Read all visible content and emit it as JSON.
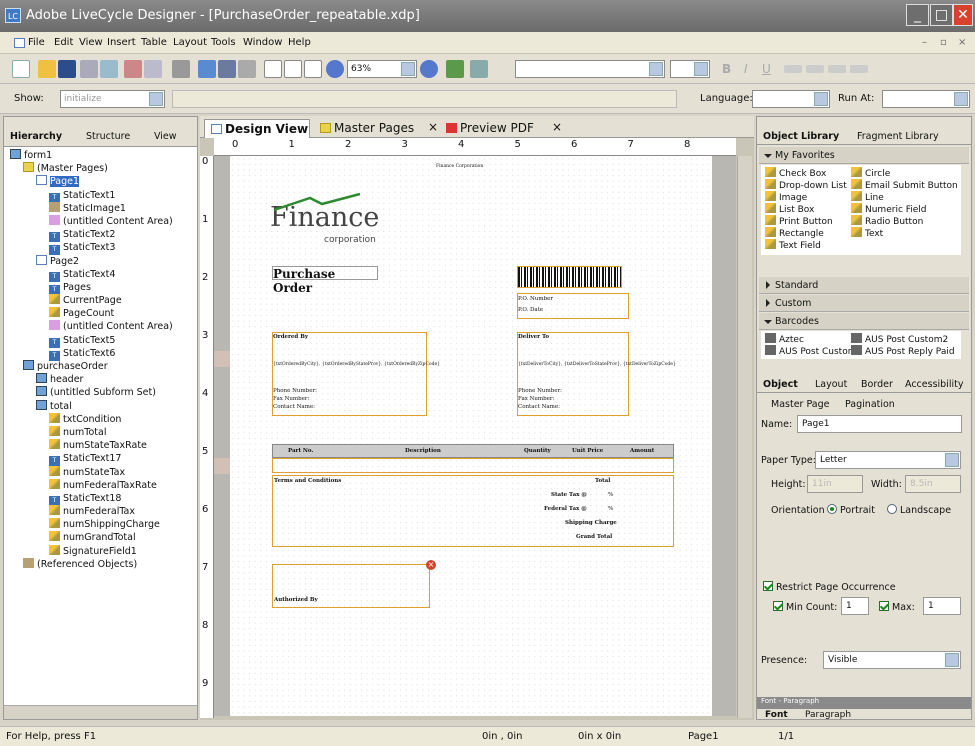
{
  "window": {
    "title": "Adobe LiveCycle Designer - [PurchaseOrder_repeatable.xdp]",
    "app_icon_text": "LC",
    "min": "_",
    "max": "□",
    "close": "✕"
  },
  "menu": [
    "File",
    "Edit",
    "View",
    "Insert",
    "Table",
    "Layout",
    "Tools",
    "Window",
    "Help"
  ],
  "toolbar": {
    "zoom": "63%",
    "bold": "B",
    "italic": "I",
    "underline": "U"
  },
  "showbar": {
    "show_label": "Show:",
    "show_value": "initialize",
    "language_label": "Language:",
    "runat_label": "Run At:"
  },
  "hierarchy": {
    "tabs": [
      "Hierarchy",
      "Structure",
      "View"
    ],
    "items": [
      {
        "label": "form1",
        "depth": 0,
        "icon": "sf"
      },
      {
        "label": "(Master Pages)",
        "depth": 1,
        "icon": "fp"
      },
      {
        "label": "Page1",
        "depth": 2,
        "icon": "pg",
        "selected": true
      },
      {
        "label": "StaticText1",
        "depth": 3,
        "icon": "tt"
      },
      {
        "label": "StaticImage1",
        "depth": 3,
        "icon": "img"
      },
      {
        "label": "(untitled Content Area)",
        "depth": 3,
        "icon": "ca"
      },
      {
        "label": "StaticText2",
        "depth": 3,
        "icon": "tt"
      },
      {
        "label": "StaticText3",
        "depth": 3,
        "icon": "tt"
      },
      {
        "label": "Page2",
        "depth": 2,
        "icon": "pg"
      },
      {
        "label": "StaticText4",
        "depth": 3,
        "icon": "tt"
      },
      {
        "label": "Pages",
        "depth": 3,
        "icon": "tt"
      },
      {
        "label": "CurrentPage",
        "depth": 3,
        "icon": "fld"
      },
      {
        "label": "PageCount",
        "depth": 3,
        "icon": "fld"
      },
      {
        "label": "(untitled Content Area)",
        "depth": 3,
        "icon": "ca"
      },
      {
        "label": "StaticText5",
        "depth": 3,
        "icon": "tt"
      },
      {
        "label": "StaticText6",
        "depth": 3,
        "icon": "tt"
      },
      {
        "label": "purchaseOrder",
        "depth": 1,
        "icon": "sf"
      },
      {
        "label": "header",
        "depth": 2,
        "icon": "sf"
      },
      {
        "label": "(untitled Subform Set)",
        "depth": 2,
        "icon": "sf"
      },
      {
        "label": "total",
        "depth": 2,
        "icon": "sf"
      },
      {
        "label": "txtCondition",
        "depth": 3,
        "icon": "fld"
      },
      {
        "label": "numTotal",
        "depth": 3,
        "icon": "fld"
      },
      {
        "label": "numStateTaxRate",
        "depth": 3,
        "icon": "fld"
      },
      {
        "label": "StaticText17",
        "depth": 3,
        "icon": "tt"
      },
      {
        "label": "numStateTax",
        "depth": 3,
        "icon": "fld"
      },
      {
        "label": "numFederalTaxRate",
        "depth": 3,
        "icon": "fld"
      },
      {
        "label": "StaticText18",
        "depth": 3,
        "icon": "tt"
      },
      {
        "label": "numFederalTax",
        "depth": 3,
        "icon": "fld"
      },
      {
        "label": "numShippingCharge",
        "depth": 3,
        "icon": "fld"
      },
      {
        "label": "numGrandTotal",
        "depth": 3,
        "icon": "fld"
      },
      {
        "label": "SignatureField1",
        "depth": 3,
        "icon": "fld"
      },
      {
        "label": "(Referenced Objects)",
        "depth": 1,
        "icon": "img"
      }
    ]
  },
  "center_tabs": [
    "Design View",
    "Master Pages",
    "Preview PDF"
  ],
  "ruler_h": [
    "0",
    "1",
    "2",
    "3",
    "4",
    "5",
    "6",
    "7",
    "8"
  ],
  "ruler_v": [
    "0",
    "1",
    "2",
    "3",
    "4",
    "5",
    "6",
    "7",
    "8",
    "9"
  ],
  "form": {
    "header_text": "Finance Corporation",
    "logo_main": "Finance",
    "logo_sub": "corporation",
    "title": "Purchase Order",
    "po_number": "P.O. Number",
    "po_date": "P.O. Date",
    "ordered_by": "Ordered By",
    "deliver_to": "Deliver To",
    "ordered_city": "{txtOrderedByCity}, {txtOrderedByStateProv}, {txtOrderedByZipCode}",
    "deliver_city": "{txtDeliverToCity}, {txtDeliverToStateProv}, {txtDeliverToZipCode}",
    "phone": "Phone Number:",
    "fax": "Fax Number:",
    "contact": "Contact Name:",
    "col_part": "Part No.",
    "col_desc": "Description",
    "col_qty": "Quantity",
    "col_price": "Unit Price",
    "col_amount": "Amount",
    "terms": "Terms and Conditions",
    "total": "Total",
    "state_tax": "State Tax @",
    "federal_tax": "Federal Tax @",
    "shipping": "Shipping Charge",
    "grand_total": "Grand Total",
    "pct": "%",
    "authorized": "Authorized By"
  },
  "library": {
    "tabs": [
      "Object Library",
      "Fragment Library"
    ],
    "favorites_label": "My Favorites",
    "favorites": [
      [
        "Check Box",
        "Circle"
      ],
      [
        "Drop-down List",
        "Email Submit Button"
      ],
      [
        "Image",
        "Line"
      ],
      [
        "List Box",
        "Numeric Field"
      ],
      [
        "Print Button",
        "Radio Button"
      ],
      [
        "Rectangle",
        "Text"
      ],
      [
        "Text Field",
        ""
      ]
    ],
    "sections": [
      "Standard",
      "Custom",
      "Barcodes"
    ],
    "barcodes": [
      [
        "Aztec",
        "AUS Post Custom2"
      ],
      [
        "AUS Post Custom",
        "AUS Post Reply Paid"
      ]
    ]
  },
  "object": {
    "tabs": [
      "Object",
      "Layout",
      "Border",
      "Accessibility"
    ],
    "subtabs": [
      "Master Page",
      "Pagination"
    ],
    "name_label": "Name:",
    "name_value": "Page1",
    "paper_label": "Paper Type:",
    "paper_value": "Letter",
    "height_label": "Height:",
    "height_value": "11in",
    "width_label": "Width:",
    "width_value": "8.5in",
    "orientation_label": "Orientation",
    "portrait": "Portrait",
    "landscape": "Landscape",
    "restrict": "Restrict Page Occurrence",
    "min_label": "Min Count:",
    "min_value": "1",
    "max_label": "Max:",
    "max_value": "1",
    "presence_label": "Presence:",
    "presence_value": "Visible"
  },
  "font_panel": {
    "title": "Font - Paragraph",
    "tabs": [
      "Font",
      "Paragraph"
    ]
  },
  "status": {
    "help": "For Help, press F1",
    "pos": "0in , 0in",
    "size": "0in x 0in",
    "page": "Page1",
    "pages": "1/1"
  }
}
